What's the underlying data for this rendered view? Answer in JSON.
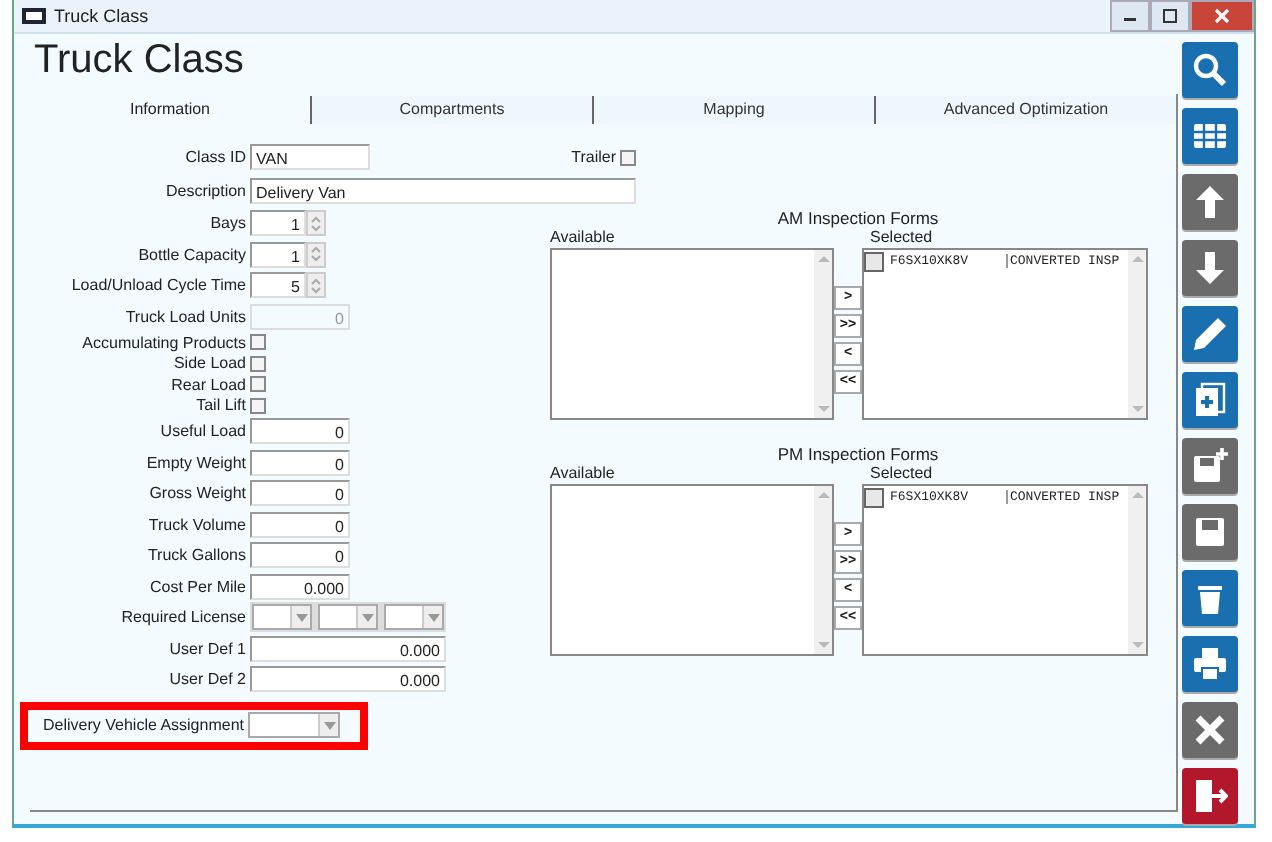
{
  "window": {
    "title": "Truck Class"
  },
  "heading": "Truck Class",
  "tabs": [
    {
      "label": "Information",
      "selected": true
    },
    {
      "label": "Compartments",
      "selected": false
    },
    {
      "label": "Mapping",
      "selected": false
    },
    {
      "label": "Advanced Optimization",
      "selected": false
    }
  ],
  "class_id": {
    "label": "Class ID",
    "value": "VAN"
  },
  "trailer": {
    "label": "Trailer",
    "checked": false
  },
  "description": {
    "label": "Description",
    "value": "Delivery Van"
  },
  "fields": [
    {
      "kind": "spin",
      "label": "Bays",
      "value": "1"
    },
    {
      "kind": "spin",
      "label": "Bottle Capacity",
      "value": "1"
    },
    {
      "kind": "spin",
      "label": "Load/Unload Cycle Time",
      "value": "5"
    },
    {
      "kind": "number",
      "label": "Truck Load Units",
      "value": "0",
      "disabled": true
    },
    {
      "kind": "check",
      "label": "Accumulating Products",
      "checked": false
    },
    {
      "kind": "check",
      "label": "Side Load",
      "checked": false
    },
    {
      "kind": "check",
      "label": "Rear Load",
      "checked": false
    },
    {
      "kind": "check",
      "label": "Tail Lift",
      "checked": false
    },
    {
      "kind": "number",
      "label": "Useful Load",
      "value": "0",
      "disabled": false
    },
    {
      "kind": "number",
      "label": "Empty Weight",
      "value": "0",
      "disabled": false
    },
    {
      "kind": "number",
      "label": "Gross Weight",
      "value": "0",
      "disabled": false
    },
    {
      "kind": "number",
      "label": "Truck Volume",
      "value": "0",
      "disabled": false
    },
    {
      "kind": "number",
      "label": "Truck Gallons",
      "value": "0",
      "disabled": false
    },
    {
      "kind": "number",
      "label": "Cost Per Mile",
      "value": "0.000",
      "disabled": false
    },
    {
      "kind": "selects",
      "label": "Required License"
    },
    {
      "kind": "wide",
      "label": "User Def 1",
      "value": "0.000"
    },
    {
      "kind": "wide",
      "label": "User Def 2",
      "value": "0.000"
    }
  ],
  "highlighted_field": {
    "label": "Delivery Vehicle Assignment"
  },
  "inspection_forms": [
    {
      "title": "AM Inspection Forms",
      "available_label": "Available",
      "selected_label": "Selected",
      "selected_rows": [
        {
          "code": "F6SX10XK8V",
          "name": "CONVERTED INSP"
        }
      ]
    },
    {
      "title": "PM Inspection Forms",
      "available_label": "Available",
      "selected_label": "Selected",
      "selected_rows": [
        {
          "code": "F6SX10XK8V",
          "name": "CONVERTED INSP"
        }
      ]
    }
  ],
  "transfer_buttons": [
    ">",
    ">>",
    "<",
    "<<"
  ],
  "toolbar": [
    {
      "kind": "search",
      "color": "#1a6fb0"
    },
    {
      "kind": "grid",
      "color": "#1a6fb0"
    },
    {
      "kind": "up",
      "color": "#6b6b6b"
    },
    {
      "kind": "down",
      "color": "#6b6b6b"
    },
    {
      "kind": "pencil",
      "color": "#1a6fb0"
    },
    {
      "kind": "adddoc",
      "color": "#1a6fb0"
    },
    {
      "kind": "savenew",
      "color": "#6b6b6b"
    },
    {
      "kind": "save",
      "color": "#6b6b6b"
    },
    {
      "kind": "trash",
      "color": "#1a6fb0"
    },
    {
      "kind": "print",
      "color": "#1a6fb0"
    },
    {
      "kind": "close",
      "color": "#6b6b6b"
    },
    {
      "kind": "exit",
      "color": "#b3172b"
    }
  ]
}
